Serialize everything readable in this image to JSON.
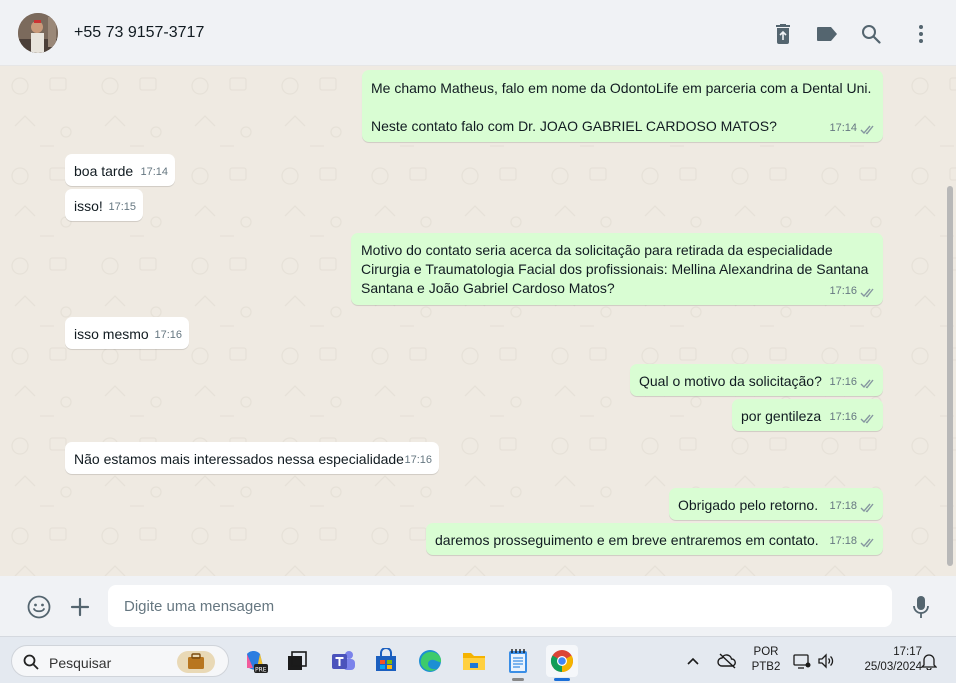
{
  "header": {
    "contact_name": "+55 73 9157-3717",
    "icons": [
      "delete-icon",
      "label-icon",
      "search-icon",
      "more-options-icon"
    ]
  },
  "messages": [
    {
      "dir": "out",
      "text": "Me chamo Matheus, falo em nome da OdontoLife em parceria com a Dental Uni.\n\nNeste contato falo com Dr. JOAO GABRIEL CARDOSO MATOS?",
      "time": "17:14"
    },
    {
      "dir": "in",
      "text": "boa tarde",
      "time": "17:14"
    },
    {
      "dir": "in",
      "text": "isso!",
      "time": "17:15"
    },
    {
      "dir": "out",
      "text": "Motivo do contato seria  acerca da solicitação para retirada da especialidade\nCirurgia e Traumatologia Facial dos profissionais: Mellina Alexandrina de Santana\nSantana e João Gabriel Cardoso Matos?",
      "time": "17:16"
    },
    {
      "dir": "in",
      "text": "isso mesmo",
      "time": "17:16"
    },
    {
      "dir": "out",
      "text": "Qual o motivo da solicitação?",
      "time": "17:16"
    },
    {
      "dir": "out",
      "text": "por gentileza",
      "time": "17:16"
    },
    {
      "dir": "in",
      "text": "Não estamos mais interessados nessa especialidade",
      "time": "17:16"
    },
    {
      "dir": "out",
      "text": "Obrigado pelo retorno.",
      "time": "17:18"
    },
    {
      "dir": "out",
      "text": "daremos prosseguimento e em breve entraremos em contato.",
      "time": "17:18"
    }
  ],
  "composer": {
    "placeholder": "Digite uma mensagem"
  },
  "taskbar": {
    "search_label": "Pesquisar",
    "apps": [
      "work-icon",
      "copilot-icon",
      "task-view-icon",
      "teams-icon",
      "store-icon",
      "edge-icon",
      "file-explorer-icon",
      "notepad-icon",
      "chrome-icon"
    ],
    "lang_top": "POR",
    "lang_bottom": "PTB2",
    "time": "17:17",
    "date": "25/03/2024"
  },
  "colors": {
    "outgoing_bubble": "#d9fdd3",
    "incoming_bubble": "#ffffff",
    "chat_background": "#efeae2",
    "tick_color": "#8696a0"
  }
}
